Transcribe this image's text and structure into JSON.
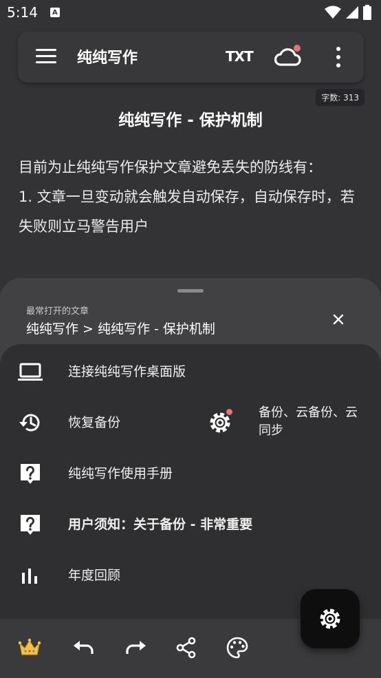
{
  "status_bar": {
    "time": "5:14",
    "notification_letter": "A"
  },
  "toolbar": {
    "title": "纯纯写作",
    "txt_label": "TXT"
  },
  "editor": {
    "word_count": "字数: 313",
    "title": "纯纯写作 - 保护机制",
    "paragraphs": [
      "目前为止纯纯写作保护文章避免丢失的防线有：",
      "1. 文章一旦变动就会触发自动保存，自动保存时，若失败则立马警告用户"
    ]
  },
  "sheet": {
    "recent_label": "最常打开的文章",
    "recent_path": "纯纯写作 > 纯纯写作 - 保护机制",
    "items": [
      {
        "label": "连接纯纯写作桌面版",
        "icon": "laptop-icon"
      },
      {
        "label": "恢复备份",
        "icon": "restore-history-icon"
      },
      {
        "label": "纯纯写作使用手册",
        "icon": "help-icon"
      },
      {
        "label": "用户须知：关于备份 - 非常重要",
        "icon": "help-icon"
      },
      {
        "label": "年度回顾",
        "icon": "bar-chart-icon"
      }
    ],
    "backup_settings_label": "备份、云备份、云同步"
  },
  "bottom_bar": {
    "icons": [
      "crown-icon",
      "undo-icon",
      "redo-icon",
      "share-icon",
      "palette-icon"
    ]
  },
  "fab": {
    "icon": "settings-icon"
  },
  "colors": {
    "background": "#333336",
    "sheet": "#414143",
    "menu_panel": "#2f2f31",
    "badge_dot": "#e57373",
    "crown": "#f5c542"
  }
}
